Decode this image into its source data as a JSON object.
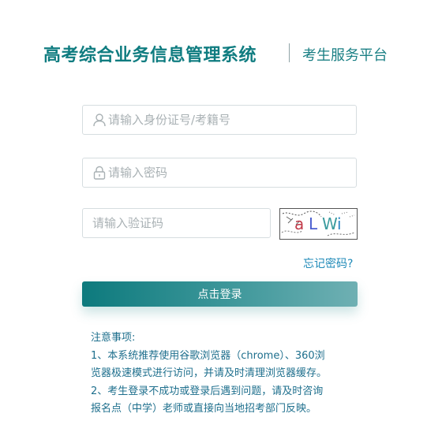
{
  "header": {
    "title": "高考综合业务信息管理系统",
    "subtitle": "考生服务平台"
  },
  "form": {
    "username_placeholder": "请输入身份证号/考籍号",
    "password_placeholder": "请输入密码",
    "captcha_placeholder": "请输入验证码",
    "captcha_text": [
      "a",
      "L",
      "W",
      "i"
    ],
    "forgot_label": "忘记密码?",
    "login_label": "点击登录"
  },
  "notes": {
    "heading": "注意事项:",
    "lines": [
      "1、本系统推荐使用谷歌浏览器（chrome）、360浏",
      "览器极速模式进行访问，并请及时清理浏览器缓存。",
      "2、考生登录不成功或登录后遇到问题，请及时咨询",
      "报名点（中学）老师或直接向当地招考部门反映。"
    ]
  },
  "colors": {
    "brand": "#0f7c80",
    "link": "#1f8ab8",
    "notes_text": "#1e6f8d"
  }
}
